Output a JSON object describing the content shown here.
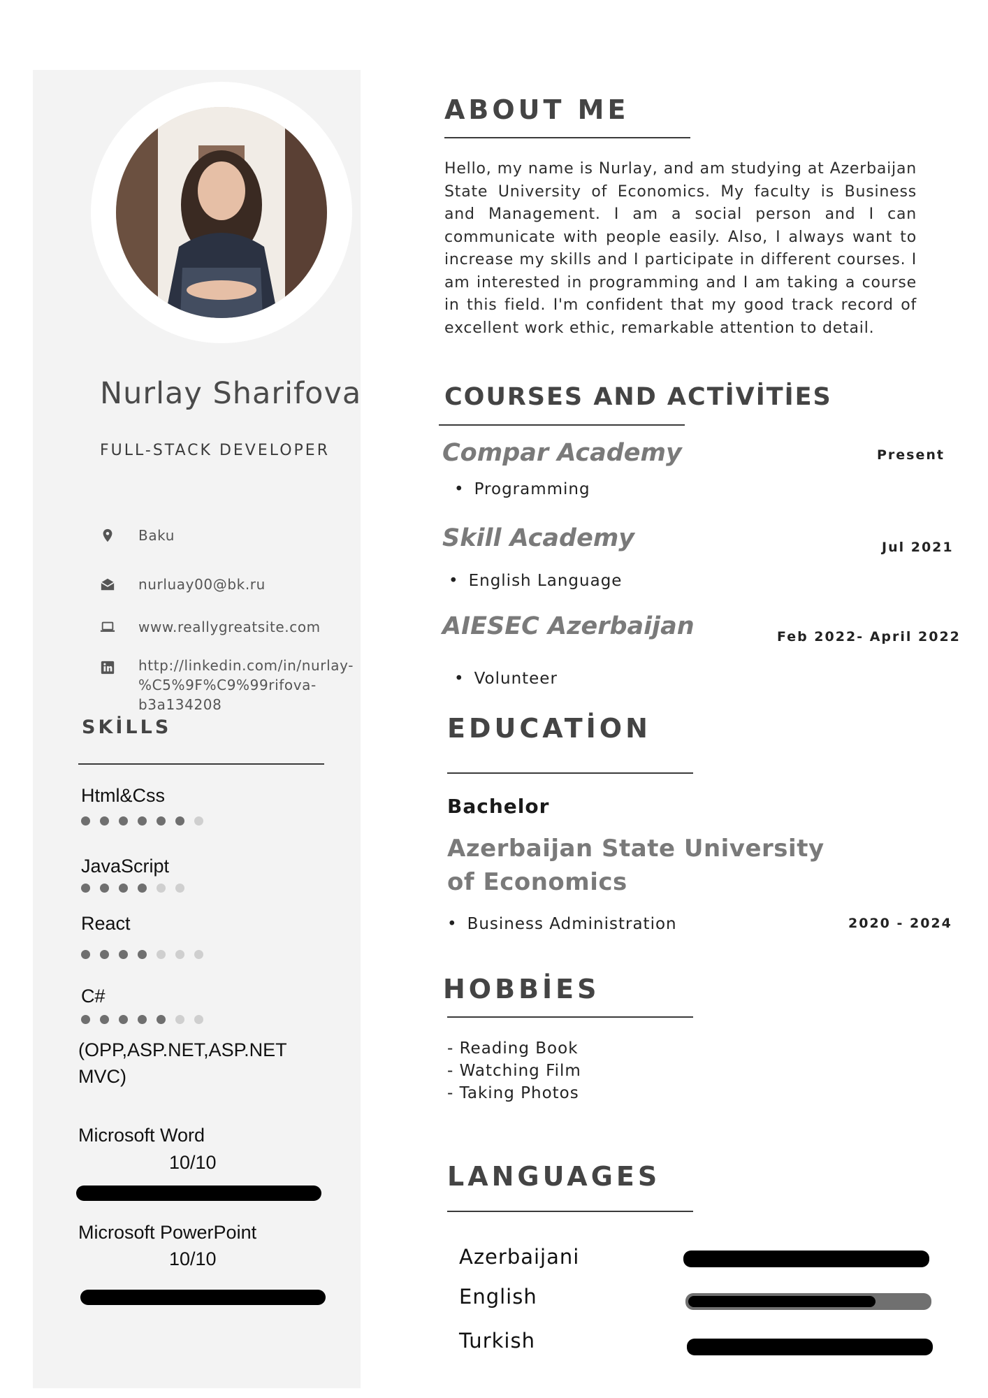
{
  "profile": {
    "name": "Nurlay Sharifova",
    "role": "FULL-STACK DEVELOPER"
  },
  "contact": {
    "location": "Baku",
    "email": "nurluay00@bk.ru",
    "website": "www.reallygreatsite.com",
    "linkedin_line1": "http://linkedin.com/in/nurlay-",
    "linkedin_line2": "%C5%9F%C9%99rifova-",
    "linkedin_line3": "b3a134208"
  },
  "skills": {
    "heading": "SKİLLS",
    "items": [
      {
        "label": "Html&Css",
        "rating": 6,
        "max": 7
      },
      {
        "label": "JavaScript",
        "rating": 4,
        "max": 6
      },
      {
        "label": "React",
        "rating": 4,
        "max": 7
      },
      {
        "label": "C#",
        "rating": 5,
        "max": 7
      }
    ],
    "csharp_note_line1": "(OPP,ASP.NET,ASP.NET",
    "csharp_note_line2": "MVC)",
    "tools": [
      {
        "label": "Microsoft Word",
        "score": "10/10",
        "level": 1.0
      },
      {
        "label": "Microsoft PowerPoint",
        "score": "10/10",
        "level": 1.0
      }
    ]
  },
  "about": {
    "heading": "ABOUT ME",
    "text": "Hello, my name is Nurlay, and am studying at Azerbaijan State University of Economics. My faculty is Business and Management. I am a social person and I can communicate with people easily. Also, I always want to increase my skills and I participate in different courses. I am interested in programming and I am taking a course in this field. I'm confident that my good track record of excellent work ethic, remarkable attention to detail."
  },
  "courses": {
    "heading": "COURSES AND ACTİVİTİES",
    "items": [
      {
        "org": "Compar Academy",
        "date": "Present",
        "detail": "Programming"
      },
      {
        "org": "Skill Academy",
        "date": "Jul 2021",
        "detail": "English Language"
      },
      {
        "org": "AIESEC Azerbaijan",
        "date": "Feb 2022- April 2022",
        "detail": "Volunteer"
      }
    ]
  },
  "education": {
    "heading": "EDUCATİON",
    "degree": "Bachelor",
    "university": "Azerbaijan State University of Economics",
    "field": "Business Administration",
    "years": "2020 - 2024"
  },
  "hobbies": {
    "heading": "HOBBİES",
    "items": [
      "- Reading Book",
      "- Watching Film",
      "- Taking Photos"
    ]
  },
  "languages": {
    "heading": "LANGUAGES",
    "items": [
      {
        "name": "Azerbaijani",
        "level": 1.0
      },
      {
        "name": "English",
        "level": 0.78
      },
      {
        "name": "Turkish",
        "level": 1.0
      }
    ]
  },
  "colors": {
    "sidebar_bg": "#f3f3f3",
    "heading": "#444444",
    "accent_gray": "#7a7a7a",
    "bar_fill": "#000000",
    "bar_track": "#707070"
  }
}
